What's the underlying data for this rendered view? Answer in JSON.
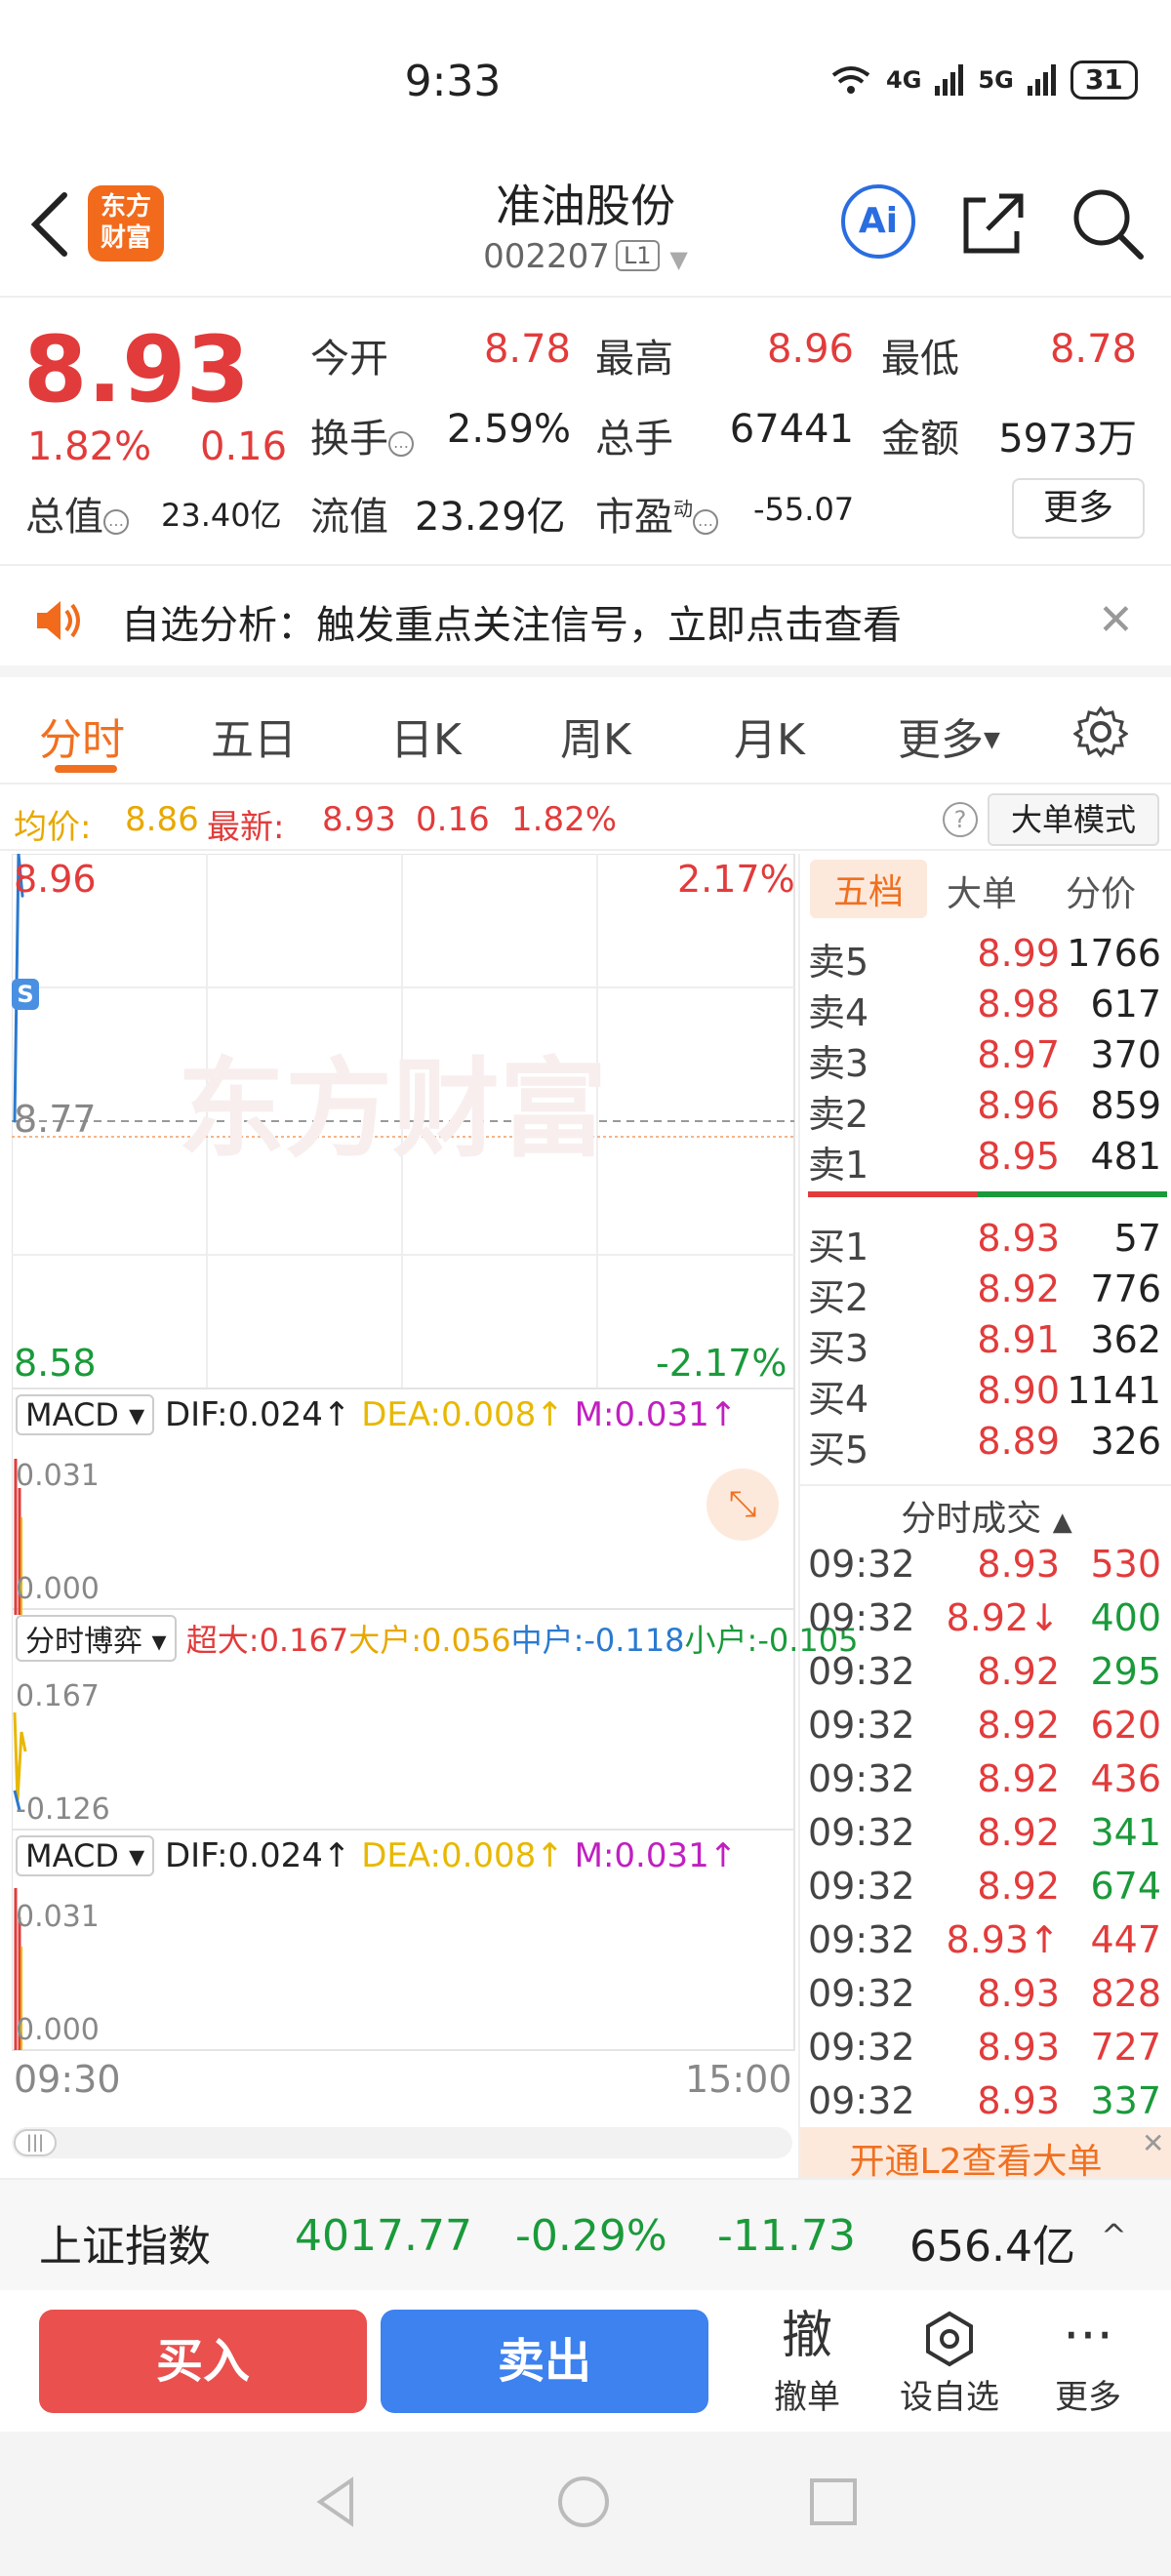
{
  "status_bar": {
    "time": "9:33",
    "net1": "4G",
    "net2": "5G",
    "battery": "31"
  },
  "header": {
    "logo_text": "东方\n财富",
    "stock_name": "准油股份",
    "stock_code": "002207",
    "level": "L1",
    "ai_label": "Ai"
  },
  "quote": {
    "price": "8.93",
    "change_pct": "1.82%",
    "change_amt": "0.16",
    "open_label": "今开",
    "open": "8.78",
    "high_label": "最高",
    "high": "8.96",
    "low_label": "最低",
    "low": "8.78",
    "turnover_label": "换手",
    "turnover": "2.59%",
    "volume_label": "总手",
    "volume": "67441",
    "amount_label": "金额",
    "amount": "5973万",
    "mktcap_label": "总值",
    "mktcap": "23.40亿",
    "float_label": "流值",
    "float": "23.29亿",
    "pe_label": "市盈",
    "pe_sup": "动",
    "pe": "-55.07",
    "more": "更多"
  },
  "alert": {
    "text": "自选分析：触发重点关注信号，立即点击查看"
  },
  "tabs": [
    "分时",
    "五日",
    "日K",
    "周K",
    "月K",
    "更多"
  ],
  "avg_row": {
    "avg_label": "均价:",
    "avg": "8.86",
    "latest_label": "最新:",
    "latest": "8.93",
    "chg": "0.16",
    "pct": "1.82%",
    "help": "?",
    "mode_button": "大单模式"
  },
  "chart": {
    "price_high": "8.96",
    "price_low": "8.58",
    "price_mid": "8.77",
    "pct_high": "2.17%",
    "pct_low": "-2.17%",
    "marker": "S",
    "watermark": "东方财富",
    "time_start": "09:30",
    "time_end": "15:00",
    "macd1": {
      "name": "MACD",
      "dif": "DIF:0.024↑",
      "dea": "DEA:0.008↑",
      "m": "M:0.031↑",
      "top": "0.031",
      "bottom": "0.000"
    },
    "game": {
      "name": "分时博弈",
      "super": "超大:0.167",
      "big": "大户:0.056",
      "mid": "中户:-0.118",
      "small": "小户:-0.105",
      "top": "0.167",
      "bottom": "-0.126"
    },
    "macd2": {
      "name": "MACD",
      "dif": "DIF:0.024↑",
      "dea": "DEA:0.008↑",
      "m": "M:0.031↑",
      "top": "0.031",
      "bottom": "0.000"
    }
  },
  "chart_data": {
    "type": "line",
    "ylim": [
      8.58,
      8.96
    ],
    "x": [
      "09:30",
      "09:31",
      "09:32"
    ],
    "series": [
      {
        "values": [
          8.77,
          8.96,
          8.93
        ]
      }
    ]
  },
  "right_panel": {
    "tabs": [
      "五档",
      "大单",
      "分价"
    ],
    "asks": [
      {
        "label": "卖5",
        "price": "8.99",
        "vol": "1766"
      },
      {
        "label": "卖4",
        "price": "8.98",
        "vol": "617"
      },
      {
        "label": "卖3",
        "price": "8.97",
        "vol": "370"
      },
      {
        "label": "卖2",
        "price": "8.96",
        "vol": "859"
      },
      {
        "label": "卖1",
        "price": "8.95",
        "vol": "481"
      }
    ],
    "bids": [
      {
        "label": "买1",
        "price": "8.93",
        "vol": "57"
      },
      {
        "label": "买2",
        "price": "8.92",
        "vol": "776"
      },
      {
        "label": "买3",
        "price": "8.91",
        "vol": "362"
      },
      {
        "label": "买4",
        "price": "8.90",
        "vol": "1141"
      },
      {
        "label": "买5",
        "price": "8.89",
        "vol": "326"
      }
    ],
    "trades_title": "分时成交",
    "trades": [
      {
        "time": "09:32",
        "price": "8.93",
        "vol": "530",
        "color": "#e23b3b"
      },
      {
        "time": "09:32",
        "price": "8.92↓",
        "vol": "400",
        "color": "#1a9a3a"
      },
      {
        "time": "09:32",
        "price": "8.92",
        "vol": "295",
        "color": "#1a9a3a"
      },
      {
        "time": "09:32",
        "price": "8.92",
        "vol": "620",
        "color": "#e23b3b"
      },
      {
        "time": "09:32",
        "price": "8.92",
        "vol": "436",
        "color": "#e23b3b"
      },
      {
        "time": "09:32",
        "price": "8.92",
        "vol": "341",
        "color": "#1a9a3a"
      },
      {
        "time": "09:32",
        "price": "8.92",
        "vol": "674",
        "color": "#1a9a3a"
      },
      {
        "time": "09:32",
        "price": "8.93↑",
        "vol": "447",
        "color": "#e23b3b"
      },
      {
        "time": "09:32",
        "price": "8.93",
        "vol": "828",
        "color": "#e23b3b"
      },
      {
        "time": "09:32",
        "price": "8.93",
        "vol": "727",
        "color": "#e23b3b"
      },
      {
        "time": "09:32",
        "price": "8.93",
        "vol": "337",
        "color": "#1a9a3a"
      }
    ],
    "l2_banner": "开通L2查看大单"
  },
  "index_bar": {
    "name": "上证指数",
    "value": "4017.77",
    "pct": "-0.29%",
    "chg": "-11.73",
    "amount": "656.4亿"
  },
  "actions": {
    "buy": "买入",
    "sell": "卖出",
    "cancel_icon": "撤",
    "cancel": "撤单",
    "watch": "设自选",
    "more": "更多"
  }
}
